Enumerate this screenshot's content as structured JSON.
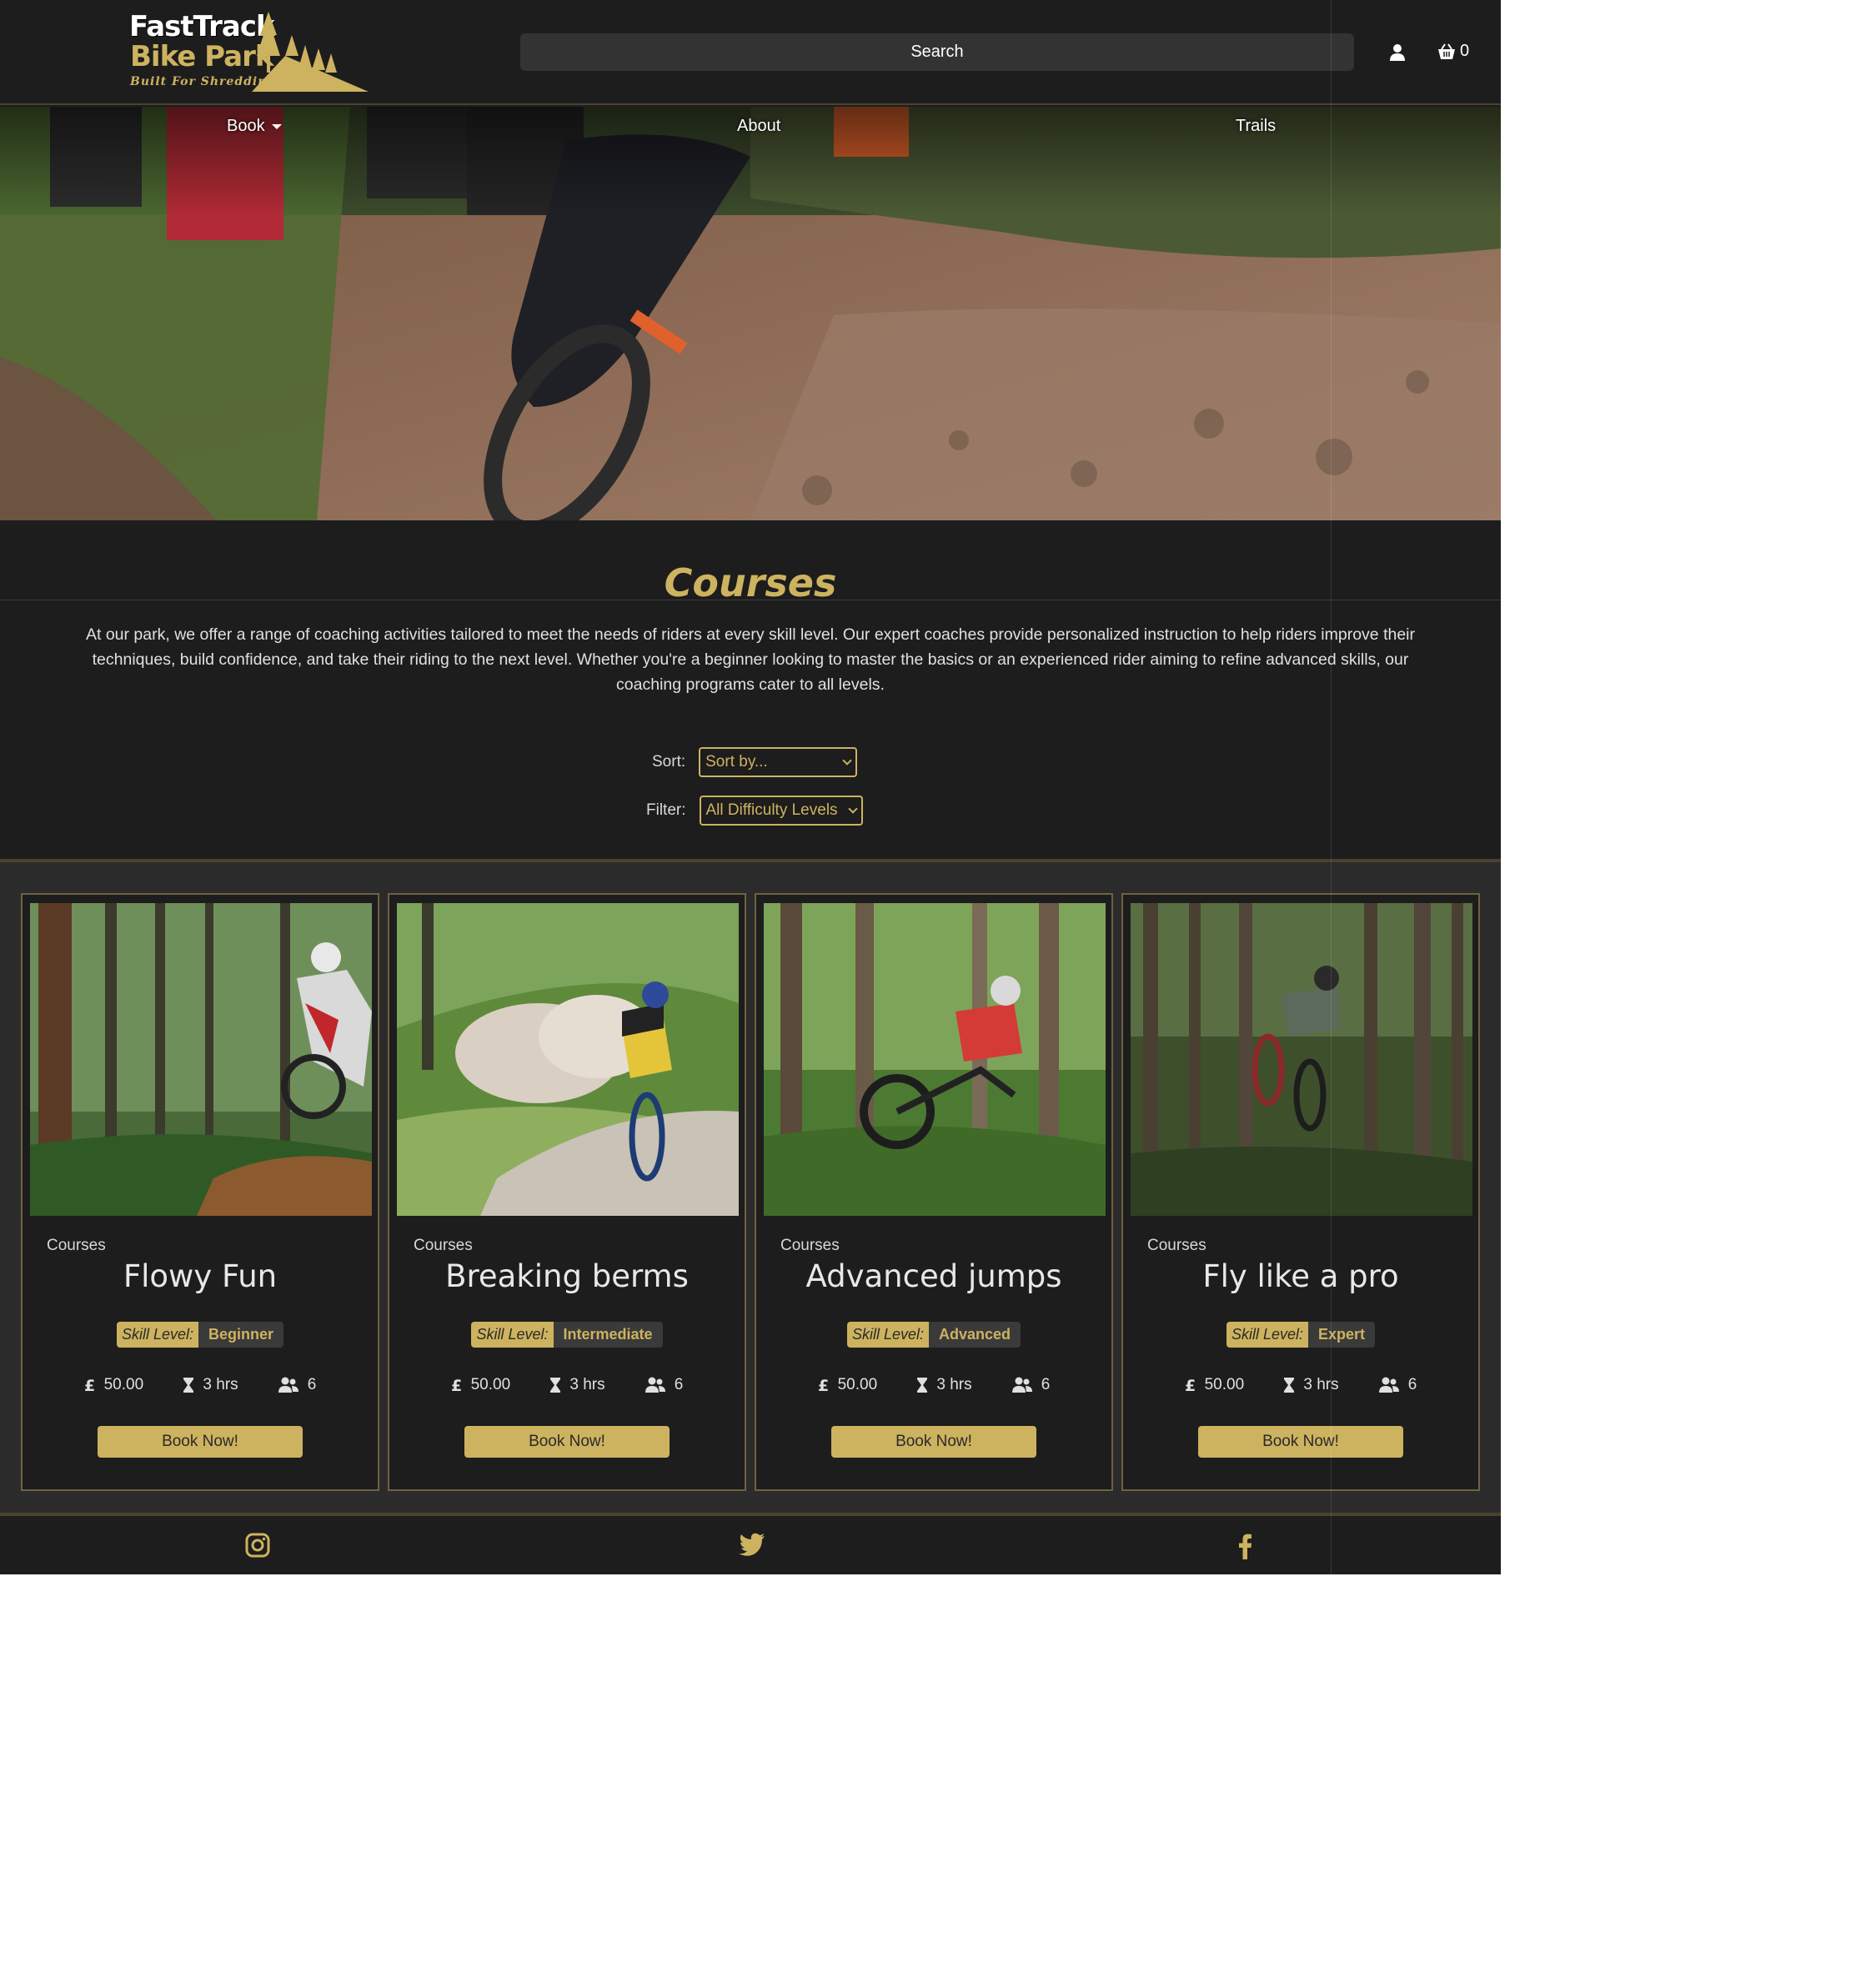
{
  "header": {
    "logo": {
      "line1": "FastTrack",
      "line2": "Bike Park",
      "tagline": "Built For Shredding"
    },
    "search_label": "Search",
    "basket_count": "0"
  },
  "nav": {
    "book": "Book",
    "about": "About",
    "trails": "Trails"
  },
  "main": {
    "title": "Courses",
    "intro": "At our park, we offer a range of coaching activities tailored to meet the needs of riders at every skill level. Our expert coaches provide personalized instruction to help riders improve their techniques, build confidence, and take their riding to the next level. Whether you're a beginner looking to master the basics or an experienced rider aiming to refine advanced skills, our coaching programs cater to all levels.",
    "sort": {
      "label": "Sort:",
      "value": "Sort by..."
    },
    "filter": {
      "label": "Filter:",
      "value": "All Difficulty Levels"
    }
  },
  "cards": [
    {
      "category": "Courses",
      "name": "Flowy Fun",
      "skill_label": "Skill Level:",
      "skill": "Beginner",
      "price": "50.00",
      "duration": "3 hrs",
      "group": "6",
      "button": "Book Now!"
    },
    {
      "category": "Courses",
      "name": "Breaking berms",
      "skill_label": "Skill Level:",
      "skill": "Intermediate",
      "price": "50.00",
      "duration": "3 hrs",
      "group": "6",
      "button": "Book Now!"
    },
    {
      "category": "Courses",
      "name": "Advanced jumps",
      "skill_label": "Skill Level:",
      "skill": "Advanced",
      "price": "50.00",
      "duration": "3 hrs",
      "group": "6",
      "button": "Book Now!"
    },
    {
      "category": "Courses",
      "name": "Fly like a pro",
      "skill_label": "Skill Level:",
      "skill": "Expert",
      "price": "50.00",
      "duration": "3 hrs",
      "group": "6",
      "button": "Book Now!"
    }
  ],
  "colors": {
    "accent": "#cdb35f",
    "background": "#1d1d1d",
    "panel": "#2b2b2b"
  },
  "icons": {
    "user": "user-icon",
    "basket": "basket-icon",
    "price": "pound-icon",
    "duration": "hourglass-icon",
    "group": "users-icon",
    "instagram": "instagram-icon",
    "twitter": "twitter-icon",
    "facebook": "facebook-icon"
  }
}
